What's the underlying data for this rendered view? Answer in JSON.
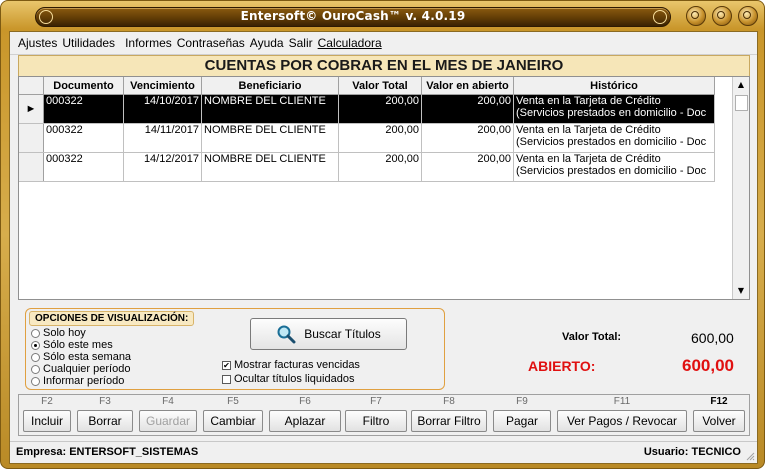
{
  "window": {
    "title": "Entersoft© OuroCash™ v. 4.0.19"
  },
  "menu": [
    "Ajustes",
    "Utilidades",
    "Informes",
    "Contraseñas",
    "Ayuda",
    "Salir",
    "Calculadora"
  ],
  "heading": "CUENTAS POR COBRAR EN EL MES DE JANEIRO",
  "table": {
    "columns": [
      "Documento",
      "Vencimiento",
      "Beneficiario",
      "Valor Total",
      "Valor en abierto",
      "Histórico"
    ],
    "rows": [
      {
        "documento": "000322",
        "vencimiento": "14/10/2017",
        "beneficiario": "NOMBRE DEL CLIENTE",
        "valor_total": "200,00",
        "valor_abierto": "200,00",
        "historico_1": "Venta en la Tarjeta de Crédito",
        "historico_2": "(Servicios prestados en domicilio - Doc"
      },
      {
        "documento": "000322",
        "vencimiento": "14/11/2017",
        "beneficiario": "NOMBRE DEL CLIENTE",
        "valor_total": "200,00",
        "valor_abierto": "200,00",
        "historico_1": "Venta en la Tarjeta de Crédito",
        "historico_2": "(Servicios prestados en domicilio - Doc"
      },
      {
        "documento": "000322",
        "vencimiento": "14/12/2017",
        "beneficiario": "NOMBRE DEL CLIENTE",
        "valor_total": "200,00",
        "valor_abierto": "200,00",
        "historico_1": "Venta en la Tarjeta de Crédito",
        "historico_2": "(Servicios prestados en domicilio - Doc"
      }
    ]
  },
  "options": {
    "title": "OPCIONES DE VISUALIZACIÓN:",
    "radios": [
      "Solo hoy",
      "Sólo este mes",
      "Sólo esta semana",
      "Cualquier período",
      "Informar período"
    ],
    "selected": "Sólo este mes",
    "search_label": "Buscar Títulos",
    "check_vencidas": "Mostrar facturas vencidas",
    "check_vencidas_checked": true,
    "check_liquidados": "Ocultar títulos liquidados",
    "check_liquidados_checked": false
  },
  "totals": {
    "total_label": "Valor Total:",
    "total_value": "600,00",
    "abierto_label": "ABIERTO:",
    "abierto_value": "600,00",
    "abierto_color": "#e01010"
  },
  "fkeys": [
    {
      "key": "F2",
      "label": "Incluir"
    },
    {
      "key": "F3",
      "label": "Borrar"
    },
    {
      "key": "F4",
      "label": "Guardar",
      "disabled": true
    },
    {
      "key": "F5",
      "label": "Cambiar"
    },
    {
      "key": "F6",
      "label": "Aplazar"
    },
    {
      "key": "F7",
      "label": "Filtro"
    },
    {
      "key": "F8",
      "label": "Borrar Filtro"
    },
    {
      "key": "F9",
      "label": "Pagar"
    },
    {
      "key": "F11",
      "label": "Ver Pagos / Revocar"
    },
    {
      "key": "F12",
      "label": "Volver"
    }
  ],
  "status": {
    "empresa": "Empresa: ENTERSOFT_SISTEMAS",
    "usuario": "Usuario: TECNICO"
  }
}
